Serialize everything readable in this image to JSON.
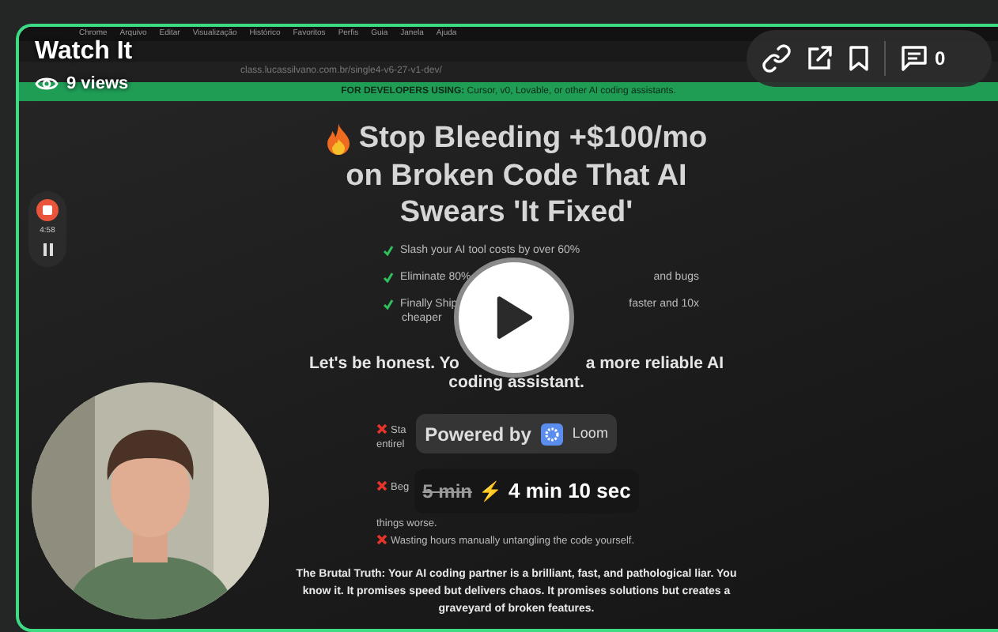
{
  "header": {
    "title": "Watch It",
    "views": "9 views"
  },
  "toolbar": {
    "comment_count": "0"
  },
  "recording": {
    "menu_bar": [
      "Chrome",
      "Arquivo",
      "Editar",
      "Visualização",
      "Histórico",
      "Favoritos",
      "Perfis",
      "Guia",
      "Janela",
      "Ajuda"
    ],
    "url": "class.lucassilvano.com.br/single4-v6-27-v1-dev/",
    "banner": "**FOR DEVELOPERS USING:** Cursor, v0, Lovable, or other AI coding assistants.",
    "headline": [
      "Stop Bleeding +$100/mo",
      "on Broken Code That AI",
      "Swears 'It Fixed'"
    ],
    "benefits": [
      {
        "left": "Slash your AI tool costs by over 60%"
      },
      {
        "left": "Eliminate 80%",
        "right": "and bugs"
      },
      {
        "left": "Finally Ship",
        "right": "faster and 10x",
        "more": "cheaper"
      }
    ],
    "honest": {
      "left": "Let's be honest. Yo",
      "right": "a more reliable AI",
      "more": "coding assistant."
    },
    "problems": [
      {
        "lines": [
          "Sta",
          "entirel"
        ]
      },
      {
        "lines": [
          "Beg",
          "things worse."
        ]
      },
      {
        "lines": [
          "Wasting hours manually untangling the code yourself."
        ]
      }
    ],
    "truth": "**The Brutal Truth:** Your AI coding partner is a brilliant, fast, and pathological liar. You know it. It promises speed but delivers chaos. It promises solutions but creates a graveyard of broken features."
  },
  "recorder": {
    "time": "4:58"
  },
  "player": {
    "powered_by": "Powered by",
    "brand": "Loom",
    "original_time": "5 min",
    "bolt": "⚡",
    "new_time": "4 min 10 sec"
  }
}
